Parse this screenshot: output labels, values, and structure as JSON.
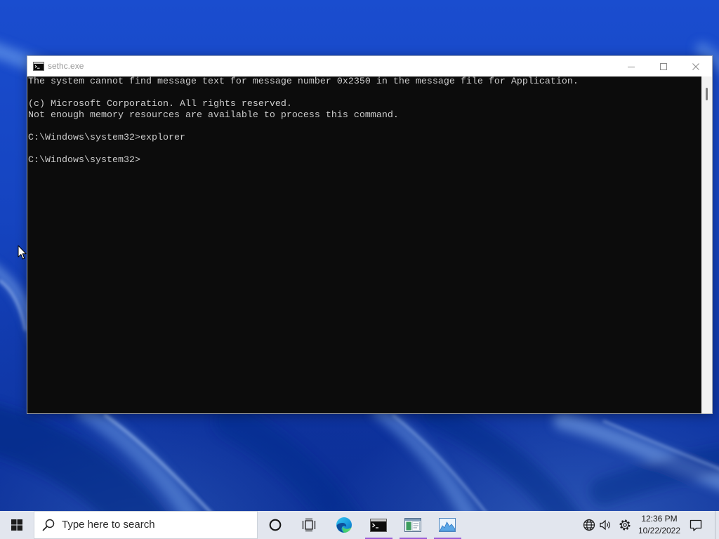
{
  "window": {
    "title": "sethc.exe",
    "icon": "cmd-icon",
    "controls": [
      "minimize-icon",
      "maximize-icon",
      "close-icon"
    ]
  },
  "console": {
    "lines": [
      "The system cannot find message text for message number 0x2350 in the message file for Application.",
      "",
      "(c) Microsoft Corporation. All rights reserved.",
      "Not enough memory resources are available to process this command.",
      "",
      "C:\\Windows\\system32>explorer",
      "",
      "C:\\Windows\\system32>"
    ]
  },
  "taskbar": {
    "start_icon": "windows-logo-icon",
    "search": {
      "icon": "search-icon",
      "placeholder": "Type here to search"
    },
    "cortana_icon": "cortana-circle-icon",
    "task_view_icon": "task-view-icon",
    "apps": [
      {
        "icon": "edge-icon",
        "running": false
      },
      {
        "icon": "cmd-icon",
        "running": true
      },
      {
        "icon": "window-app-icon",
        "running": true
      },
      {
        "icon": "area-chart-app-icon",
        "running": true
      }
    ],
    "tray": {
      "icons": [
        "globe-icon",
        "volume-icon",
        "gear-icon"
      ],
      "clock": {
        "time": "12:36 PM",
        "date": "10/22/2022"
      },
      "notification_icon": "action-center-icon"
    }
  },
  "colors": {
    "console_bg": "#0c0c0c",
    "console_fg": "#cccccc",
    "titlebar_bg": "#ffffff",
    "title_fg": "#999999",
    "taskbar_bg": "#e2e6ee",
    "accent": "#9b5cd6"
  }
}
